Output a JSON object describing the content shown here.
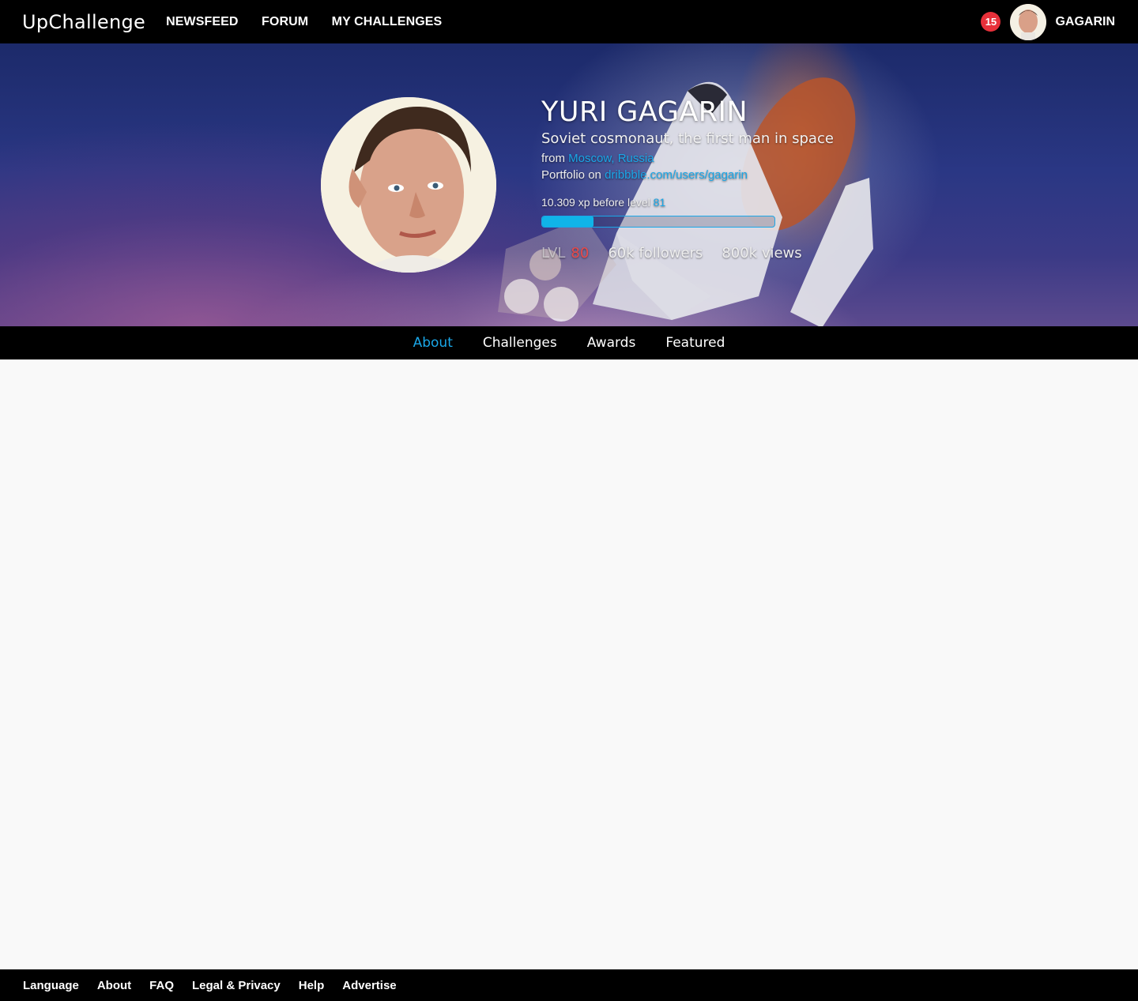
{
  "topbar": {
    "brand": "UpChallenge",
    "nav": [
      "NEWSFEED",
      "FORUM",
      "MY CHALLENGES"
    ],
    "notification_count": "15",
    "username": "GAGARIN"
  },
  "profile": {
    "name": "YURI GAGARIN",
    "tagline": "Soviet cosmonaut, the first man in space",
    "from_label": "from",
    "location": "Moscow, Russia",
    "portfolio_label": "Portfolio on",
    "portfolio_url": "dribbble.com/users/gagarin",
    "xp_text": "10.309 xp before level",
    "next_level": "81",
    "xp_progress": 0.22,
    "lvl_label": "LVL",
    "level": "80",
    "followers": "60k followers",
    "views": "800k views"
  },
  "tabs": [
    {
      "label": "About",
      "active": true
    },
    {
      "label": "Challenges",
      "active": false
    },
    {
      "label": "Awards",
      "active": false
    },
    {
      "label": "Featured",
      "active": false
    }
  ],
  "footer": {
    "links": [
      "Language",
      "About",
      "FAQ",
      "Legal & Privacy",
      "Help",
      "Advertise"
    ]
  },
  "colors": {
    "accent": "#1aa7e8",
    "badge": "#e8303a",
    "level": "#e84a4a"
  }
}
